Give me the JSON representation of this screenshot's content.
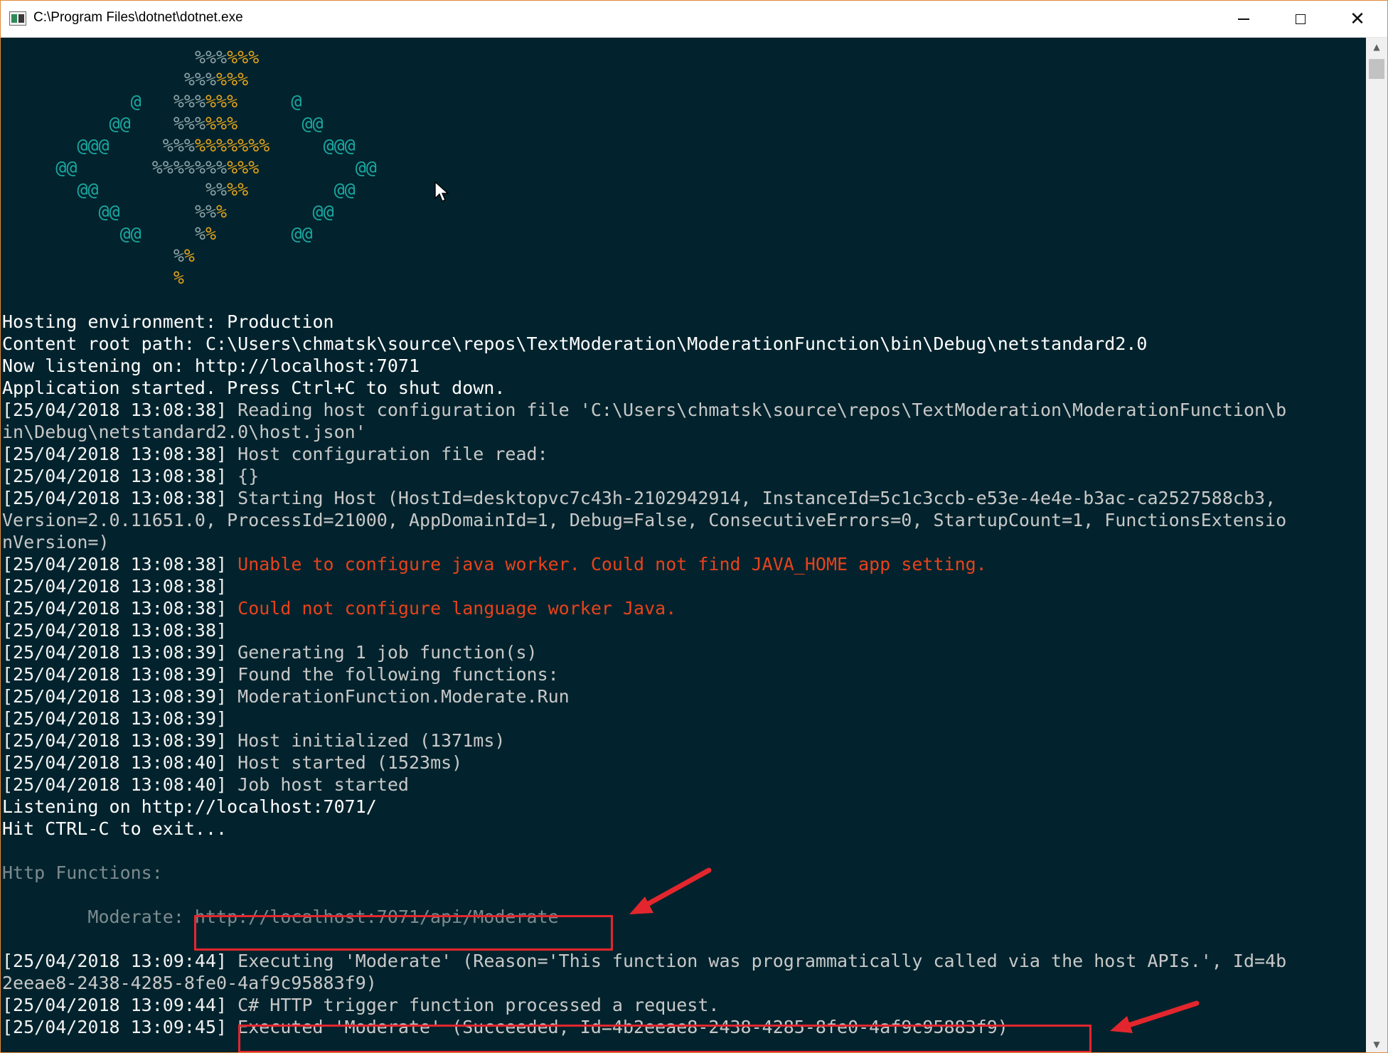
{
  "window": {
    "title": "C:\\Program Files\\dotnet\\dotnet.exe",
    "accent_color": "#e08a3c"
  },
  "titlebar": {
    "icon": "console-app-icon",
    "controls": [
      "minimize-icon",
      "maximize-icon",
      "close-icon"
    ],
    "close_glyph": "✕"
  },
  "console": {
    "background": "#02232d",
    "error_color": "#e8421b",
    "logo": [
      [
        {
          "t": "                  ",
          "c": ""
        },
        {
          "t": "%%%",
          "c": "pgray"
        },
        {
          "t": "%%%",
          "c": "porange"
        }
      ],
      [
        {
          "t": "                 ",
          "c": ""
        },
        {
          "t": "%%%",
          "c": "pgray"
        },
        {
          "t": "%%%",
          "c": "porange"
        }
      ],
      [
        {
          "t": "            ",
          "c": ""
        },
        {
          "t": "@",
          "c": "at"
        },
        {
          "t": "   ",
          "c": ""
        },
        {
          "t": "%%%",
          "c": "pgray"
        },
        {
          "t": "%%%",
          "c": "porange"
        },
        {
          "t": "     ",
          "c": ""
        },
        {
          "t": "@",
          "c": "at"
        }
      ],
      [
        {
          "t": "          ",
          "c": ""
        },
        {
          "t": "@@",
          "c": "at"
        },
        {
          "t": "    ",
          "c": ""
        },
        {
          "t": "%%%",
          "c": "pgray"
        },
        {
          "t": "%%%",
          "c": "porange"
        },
        {
          "t": "      ",
          "c": ""
        },
        {
          "t": "@@",
          "c": "at"
        }
      ],
      [
        {
          "t": "       ",
          "c": ""
        },
        {
          "t": "@@@",
          "c": "at"
        },
        {
          "t": "     ",
          "c": ""
        },
        {
          "t": "%%%",
          "c": "pgray"
        },
        {
          "t": "%%%%%%%",
          "c": "porange"
        },
        {
          "t": "     ",
          "c": ""
        },
        {
          "t": "@@@",
          "c": "at"
        }
      ],
      [
        {
          "t": "     ",
          "c": ""
        },
        {
          "t": "@@",
          "c": "at"
        },
        {
          "t": "       ",
          "c": ""
        },
        {
          "t": "%%%%%%%",
          "c": "pgray"
        },
        {
          "t": "%%%",
          "c": "porange"
        },
        {
          "t": "         ",
          "c": ""
        },
        {
          "t": "@@",
          "c": "at"
        }
      ],
      [
        {
          "t": "       ",
          "c": ""
        },
        {
          "t": "@@",
          "c": "at"
        },
        {
          "t": "          ",
          "c": ""
        },
        {
          "t": "%%",
          "c": "pgray"
        },
        {
          "t": "%%",
          "c": "porange"
        },
        {
          "t": "        ",
          "c": ""
        },
        {
          "t": "@@",
          "c": "at"
        }
      ],
      [
        {
          "t": "         ",
          "c": ""
        },
        {
          "t": "@@",
          "c": "at"
        },
        {
          "t": "       ",
          "c": ""
        },
        {
          "t": "%%",
          "c": "pgray"
        },
        {
          "t": "%",
          "c": "porange"
        },
        {
          "t": "        ",
          "c": ""
        },
        {
          "t": "@@",
          "c": "at"
        }
      ],
      [
        {
          "t": "           ",
          "c": ""
        },
        {
          "t": "@@",
          "c": "at"
        },
        {
          "t": "     ",
          "c": ""
        },
        {
          "t": "%",
          "c": "pgray"
        },
        {
          "t": "%",
          "c": "porange"
        },
        {
          "t": "       ",
          "c": ""
        },
        {
          "t": "@@",
          "c": "at"
        }
      ],
      [
        {
          "t": "                ",
          "c": ""
        },
        {
          "t": "%",
          "c": "pgray"
        },
        {
          "t": "%",
          "c": "porange"
        }
      ],
      [
        {
          "t": "                ",
          "c": ""
        },
        {
          "t": "%",
          "c": "porange"
        }
      ]
    ],
    "lines": [
      {
        "plain": ""
      },
      {
        "plain": "Hosting environment: Production"
      },
      {
        "plain": "Content root path: C:\\Users\\chmatsk\\source\\repos\\TextModeration\\ModerationFunction\\bin\\Debug\\netstandard2.0"
      },
      {
        "plain": "Now listening on: http://localhost:7071"
      },
      {
        "plain": "Application started. Press Ctrl+C to shut down."
      },
      {
        "ts": "[25/04/2018 13:08:38]",
        "msg": "Reading host configuration file 'C:\\Users\\chmatsk\\source\\repos\\TextModeration\\ModerationFunction\\b"
      },
      {
        "cont": "in\\Debug\\netstandard2.0\\host.json'"
      },
      {
        "ts": "[25/04/2018 13:08:38]",
        "msg": "Host configuration file read:"
      },
      {
        "ts": "[25/04/2018 13:08:38]",
        "msg": "{}"
      },
      {
        "ts": "[25/04/2018 13:08:38]",
        "msg": "Starting Host (HostId=desktopvc7c43h-2102942914, InstanceId=5c1c3ccb-e53e-4e4e-b3ac-ca2527588cb3,"
      },
      {
        "cont": "Version=2.0.11651.0, ProcessId=21000, AppDomainId=1, Debug=False, ConsecutiveErrors=0, StartupCount=1, FunctionsExtensio"
      },
      {
        "cont": "nVersion=)"
      },
      {
        "ts": "[25/04/2018 13:08:38]",
        "msg": "Unable to configure java worker. Could not find JAVA_HOME app setting.",
        "error": true
      },
      {
        "ts": "[25/04/2018 13:08:38]",
        "msg": ""
      },
      {
        "ts": "[25/04/2018 13:08:38]",
        "msg": "Could not configure language worker Java.",
        "error": true
      },
      {
        "ts": "[25/04/2018 13:08:38]",
        "msg": ""
      },
      {
        "ts": "[25/04/2018 13:08:39]",
        "msg": "Generating 1 job function(s)"
      },
      {
        "ts": "[25/04/2018 13:08:39]",
        "msg": "Found the following functions:"
      },
      {
        "ts": "[25/04/2018 13:08:39]",
        "msg": "ModerationFunction.Moderate.Run"
      },
      {
        "ts": "[25/04/2018 13:08:39]",
        "msg": ""
      },
      {
        "ts": "[25/04/2018 13:08:39]",
        "msg": "Host initialized (1371ms)"
      },
      {
        "ts": "[25/04/2018 13:08:40]",
        "msg": "Host started (1523ms)"
      },
      {
        "ts": "[25/04/2018 13:08:40]",
        "msg": "Job host started"
      },
      {
        "plain": "Listening on http://localhost:7071/"
      },
      {
        "plain": "Hit CTRL-C to exit..."
      },
      {
        "plain": ""
      },
      {
        "dim": "Http Functions:"
      },
      {
        "plain": ""
      },
      {
        "fn_label": "        Moderate:",
        "fn_url": " http://localhost:7071/api/Moderate"
      },
      {
        "plain": ""
      },
      {
        "ts": "[25/04/2018 13:09:44]",
        "msg": "Executing 'Moderate' (Reason='This function was programmatically called via the host APIs.', Id=4b"
      },
      {
        "cont": "2eeae8-2438-4285-8fe0-4af9c95883f9)"
      },
      {
        "ts": "[25/04/2018 13:09:44]",
        "msg": "C# HTTP trigger function processed a request."
      },
      {
        "ts": "[25/04/2018 13:09:45]",
        "msg": "Executed 'Moderate' (Succeeded, Id=4b2eeae8-2438-4285-8fe0-4af9c95883f9)"
      }
    ]
  },
  "annotations": {
    "highlight_color": "#e3262d",
    "highlighted_url": "http://localhost:7071/api/Moderate",
    "highlighted_result": "Executed 'Moderate' (Succeeded, Id=4b2eeae8-2438-4285-8fe0-4af9c95883f9)"
  },
  "scrollbar": {
    "up": "▲",
    "down": "▼"
  }
}
